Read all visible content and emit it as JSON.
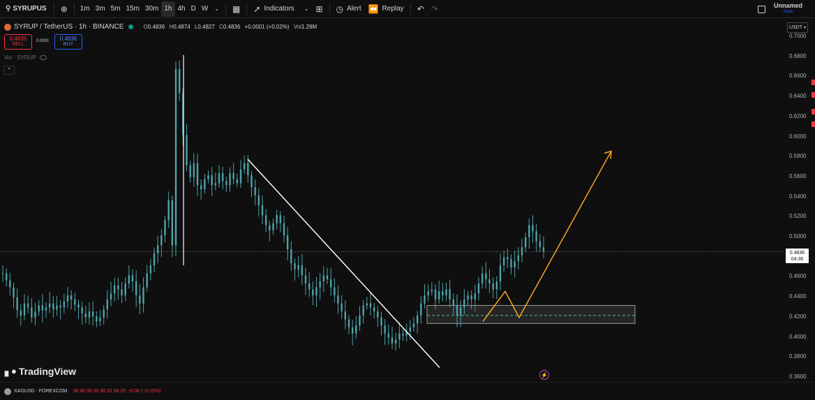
{
  "toolbar": {
    "symbol": "SYRUPUS",
    "timeframes": [
      "1m",
      "3m",
      "5m",
      "15m",
      "30m",
      "1h",
      "4h",
      "D",
      "W"
    ],
    "active_timeframe": "1h",
    "indicators_label": "Indicators",
    "alert_label": "Alert",
    "replay_label": "Replay",
    "layout_name": "Unnamed",
    "save_label": "Save"
  },
  "legend": {
    "title": "SYRUP / TetherUS · 1h · BINANCE",
    "open_label": "O",
    "open": "0.4836",
    "high_label": "H",
    "high": "0.4874",
    "low_label": "L",
    "low": "0.4827",
    "close_label": "C",
    "close": "0.4836",
    "change": "+0.0001 (+0.02%)",
    "vol_label": "Vol",
    "vol": "1.29M",
    "sell_price": "0.4835",
    "sell_label": "SELL",
    "spread": "0.0001",
    "buy_price": "0.4836",
    "buy_label": "BUY",
    "volume_indicator": "Vol · SYRUP"
  },
  "price_axis": {
    "currency": "USDT",
    "ticks": [
      "0.7000",
      "0.6800",
      "0.6600",
      "0.6400",
      "0.6200",
      "0.6000",
      "0.5800",
      "0.5600",
      "0.5400",
      "0.5200",
      "0.5000",
      "0.4800",
      "0.4600",
      "0.4400",
      "0.4200",
      "0.4000",
      "0.3800",
      "0.3600"
    ],
    "current_price": "0.4836",
    "countdown": "04:36"
  },
  "watermark": "TradingView",
  "bottom_bar": {
    "symbol": "XAGUSD · FOREXCOM",
    "values": "38.30  38.39  38.22  38.25  −0.06 (−0.15%)"
  },
  "colors": {
    "background": "#0f0f0f",
    "candle": "#4fa3a8",
    "trendline": "#ffffff",
    "projection": "#f5a623",
    "sell": "#f23645",
    "buy": "#2962ff"
  },
  "chart_data": {
    "type": "candlestick",
    "ylim": [
      0.36,
      0.7
    ],
    "close_series": [
      0.462,
      0.455,
      0.448,
      0.438,
      0.425,
      0.42,
      0.432,
      0.428,
      0.418,
      0.424,
      0.43,
      0.425,
      0.428,
      0.432,
      0.426,
      0.43,
      0.428,
      0.434,
      0.44,
      0.436,
      0.431,
      0.428,
      0.422,
      0.418,
      0.424,
      0.419,
      0.414,
      0.418,
      0.426,
      0.436,
      0.442,
      0.45,
      0.446,
      0.44,
      0.452,
      0.46,
      0.454,
      0.44,
      0.432,
      0.448,
      0.462,
      0.47,
      0.482,
      0.49,
      0.5,
      0.515,
      0.535,
      0.49,
      0.666,
      0.642,
      0.6,
      0.57,
      0.558,
      0.572,
      0.55,
      0.546,
      0.556,
      0.56,
      0.55,
      0.552,
      0.562,
      0.554,
      0.55,
      0.562,
      0.556,
      0.552,
      0.566,
      0.572,
      0.56,
      0.548,
      0.54,
      0.53,
      0.52,
      0.51,
      0.505,
      0.512,
      0.52,
      0.512,
      0.5,
      0.486,
      0.472,
      0.466,
      0.47,
      0.46,
      0.452,
      0.446,
      0.44,
      0.448,
      0.454,
      0.46,
      0.456,
      0.448,
      0.44,
      0.432,
      0.424,
      0.416,
      0.408,
      0.402,
      0.41,
      0.42,
      0.43,
      0.432,
      0.428,
      0.424,
      0.418,
      0.41,
      0.402,
      0.398,
      0.392,
      0.396,
      0.402,
      0.4,
      0.404,
      0.408,
      0.412,
      0.42,
      0.432,
      0.44,
      0.444,
      0.446,
      0.436,
      0.444,
      0.44,
      0.446,
      0.436,
      0.43,
      0.42,
      0.428,
      0.436,
      0.44,
      0.436,
      0.442,
      0.452,
      0.462,
      0.456,
      0.452,
      0.446,
      0.454,
      0.47,
      0.478,
      0.476,
      0.468,
      0.474,
      0.48,
      0.488,
      0.498,
      0.51,
      0.504,
      0.494,
      0.488,
      0.484
    ],
    "trendline": [
      [
        355,
        0.576
      ],
      [
        630,
        0.368
      ]
    ],
    "support_zone": [
      0.412,
      0.43
    ],
    "support_level": 0.42,
    "projection": [
      [
        692,
        0.414
      ],
      [
        724,
        0.444
      ],
      [
        744,
        0.418
      ],
      [
        876,
        0.584
      ]
    ],
    "current_price": 0.4836
  }
}
